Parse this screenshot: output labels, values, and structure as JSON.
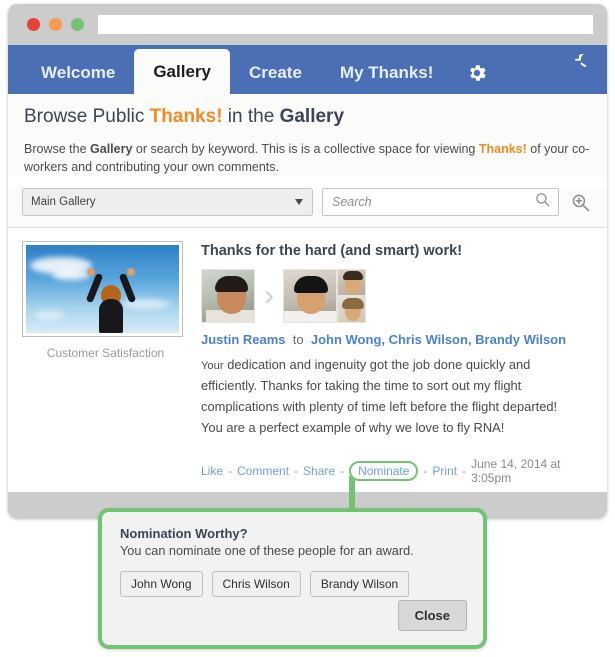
{
  "window": {
    "dots": [
      "close",
      "minimize",
      "maximize"
    ],
    "url_value": ""
  },
  "nav": {
    "tabs": [
      {
        "label": "Welcome",
        "active": false
      },
      {
        "label": "Gallery",
        "active": true
      },
      {
        "label": "Create",
        "active": false
      },
      {
        "label": "My Thanks!",
        "active": false
      }
    ],
    "gear_icon": "gear-icon",
    "refresh_icon": "refresh-icon",
    "bar_color": "#4a6fb5"
  },
  "page": {
    "title_part1": "Browse Public ",
    "title_highlight": "Thanks!",
    "title_part2": " in the ",
    "title_bold": "Gallery",
    "desc_part1": "Browse the ",
    "desc_bold1": "Gallery",
    "desc_part2": " or search by keyword. This is is a collective space for viewing ",
    "desc_highlight": "Thanks!",
    "desc_part3": " of your co-workers and contributing your own comments.",
    "accent_orange": "#ef8b22"
  },
  "filters": {
    "gallery_select_value": "Main Gallery",
    "gallery_options": [
      "Main Gallery"
    ],
    "search_placeholder": "Search",
    "search_value": "",
    "search_icon": "search-icon",
    "zoom_icon": "zoom-in-icon"
  },
  "card": {
    "thumbnail_caption": "Customer Satisfaction",
    "message_title": "Thanks for the hard (and smart) work!",
    "sender": "Justin Reams",
    "to_label": "to",
    "recipients": [
      "John Wong",
      "Chris Wilson",
      "Brandy Wilson"
    ],
    "recipients_text": "John Wong, Chris Wilson, Brandy Wilson",
    "body_first_word": "Your",
    "body_rest": " dedication and ingenuity got the job done quickly and efficiently. Thanks for taking the time to sort out my flight complications with plenty of time left before the flight departed!  You are a perfect example of why we love to fly RNA!",
    "actions": [
      "Like",
      "Comment",
      "Share",
      "Nominate",
      "Print"
    ],
    "highlighted_action": "Nominate",
    "timestamp": "June 14, 2014 at 3:05pm",
    "separator": "-"
  },
  "popup": {
    "title": "Nomination Worthy?",
    "description": "You can nominate one of these people for an award.",
    "nominee_buttons": [
      "John Wong",
      "Chris Wilson",
      "Brandy Wilson"
    ],
    "close_label": "Close",
    "border_color": "#72c472"
  }
}
